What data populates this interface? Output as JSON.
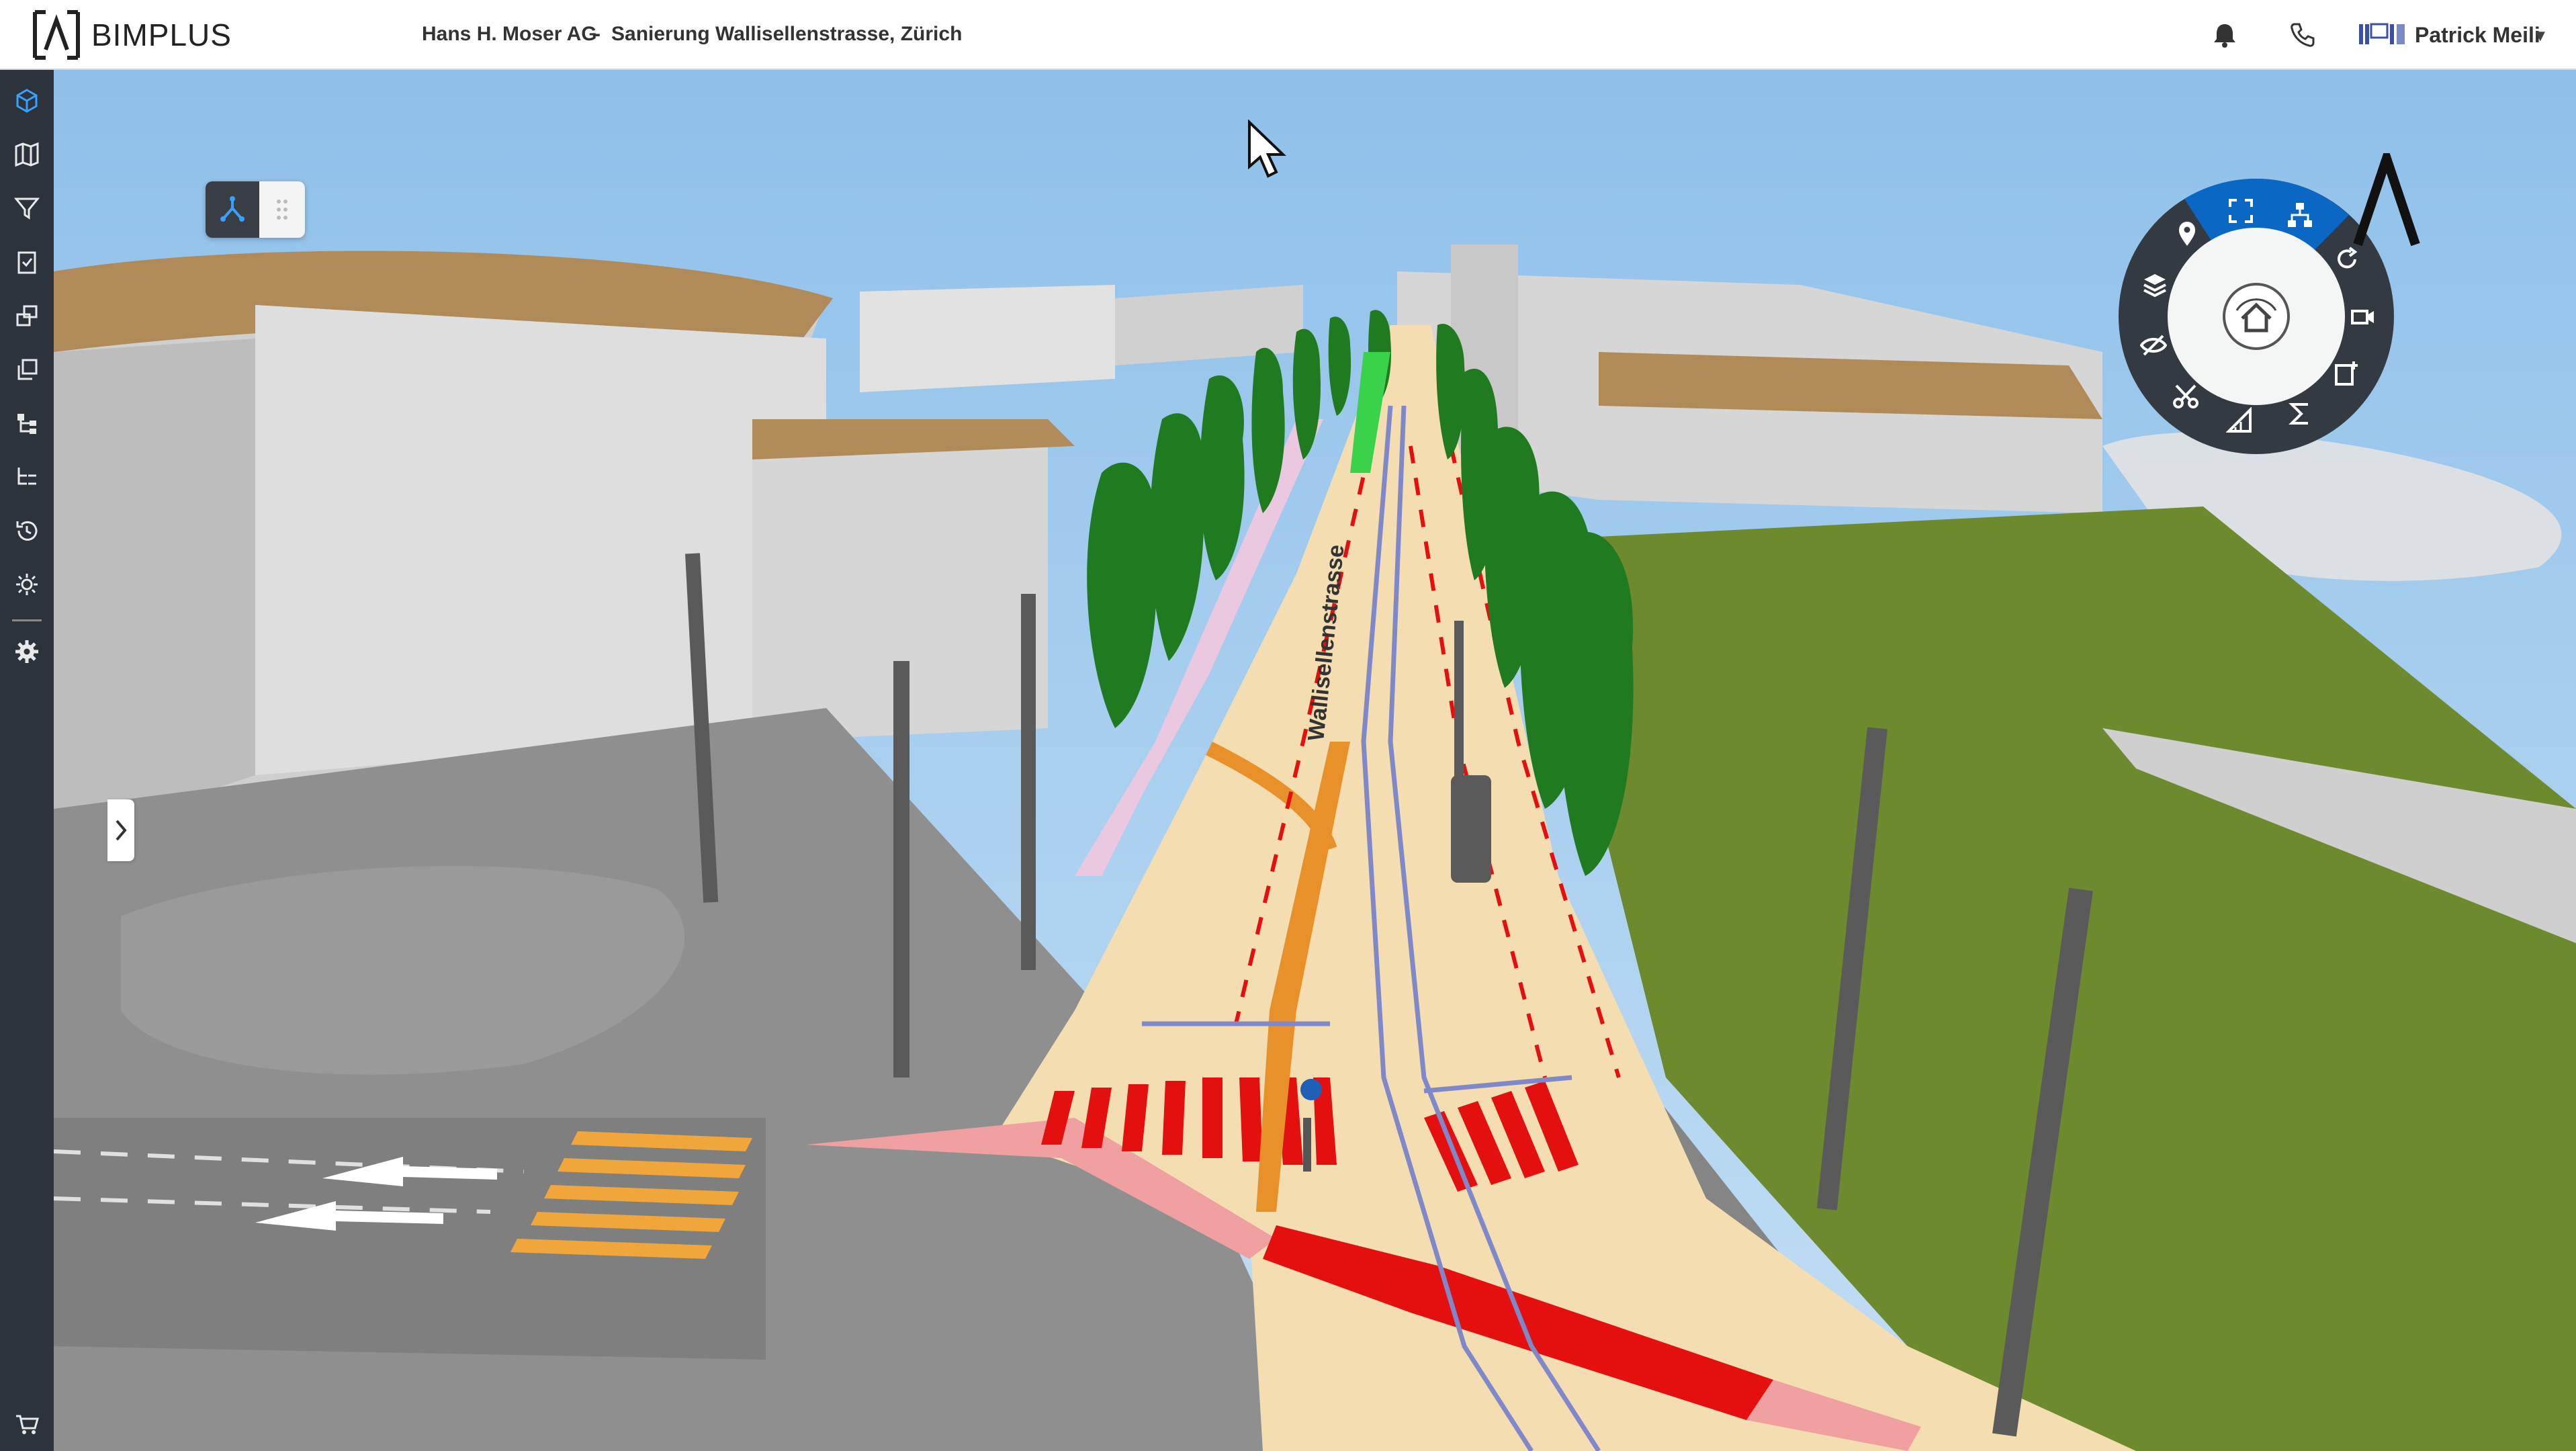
{
  "header": {
    "logo_text": "BIMPLUS",
    "company": "Hans H. Moser AG",
    "separator": "-",
    "project": "Sanierung Wallisellenstrasse, Zürich",
    "user_name": "Patrick Meili",
    "icons": [
      "bimplus-logo-icon",
      "bell-icon",
      "phone-icon",
      "company-logo-icon",
      "caret-down-icon"
    ]
  },
  "sidebar": {
    "items": [
      {
        "name": "model-3d-icon",
        "active": true
      },
      {
        "name": "map-icon"
      },
      {
        "name": "filter-icon"
      },
      {
        "name": "clipboard-check-icon"
      },
      {
        "name": "objects-icon"
      },
      {
        "name": "layers-copy-icon"
      },
      {
        "name": "hierarchy-icon"
      },
      {
        "name": "structure-icon"
      },
      {
        "name": "history-icon"
      },
      {
        "name": "brightness-icon"
      },
      {
        "name": "settings-icon"
      }
    ],
    "bottom_item": {
      "name": "cart-icon"
    }
  },
  "viewport": {
    "street_label": "Wallisellenstrasse",
    "view_toggle": {
      "active": "3d-view",
      "icons": [
        "tree-view-icon",
        "grid-dots-icon"
      ]
    },
    "radial_menu": {
      "center": "home-view-icon",
      "items": [
        "fit-screen-icon",
        "structure-icon",
        "rotate-icon",
        "camera-icon",
        "add-view-icon",
        "sum-icon",
        "measure-icon",
        "scissors-icon",
        "hide-icon",
        "layers-icon",
        "location-pin-icon"
      ]
    }
  },
  "colors": {
    "accent": "#0a68c4",
    "sidebar_bg": "#2d333a",
    "sky": "#9fc6ea",
    "grass": "#6b8a2c",
    "road": "#8d8d8d",
    "pavement": "#f4ddb0",
    "marking_red": "#e41010"
  }
}
